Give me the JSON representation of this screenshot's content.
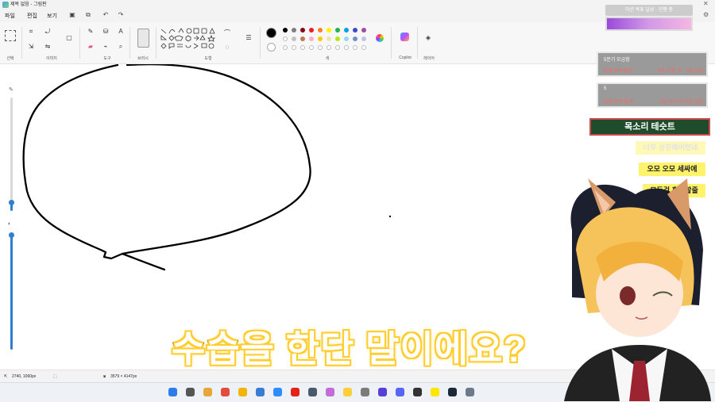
{
  "window": {
    "title": "제목 없음 - 그림판"
  },
  "menu": {
    "file": "파일",
    "edit": "편집",
    "view": "보기"
  },
  "ribbon": {
    "groups": {
      "select": "선택",
      "image": "이미지",
      "tools": "도구",
      "brushes": "브러시",
      "shapes": "도형",
      "colors": "색",
      "copilot": "Copilot",
      "layers": "레이어"
    },
    "text_tool": "A",
    "colors_row1": [
      "#000000",
      "#7f7f7f",
      "#880015",
      "#ed1c24",
      "#ff7f27",
      "#fff200",
      "#22b14c",
      "#00a2e8",
      "#3f48cc",
      "#a349a4"
    ],
    "colors_row2": [
      "#ffffff",
      "#c3c3c3",
      "#b97a57",
      "#ffaec9",
      "#ffc90e",
      "#efe4b0",
      "#b5e61d",
      "#99d9ea",
      "#7092be",
      "#c8bfe7"
    ],
    "primary_color": "#000000",
    "secondary_color": "#ffffff"
  },
  "status": {
    "cursor": "2740, 1060px",
    "canvas_size": "3579 × 4147px"
  },
  "overlay": {
    "top_banner": "미션 목표 달성 · 진행 중",
    "cards": [
      {
        "title": "5분기 모금함",
        "left": "연결 문제 발생",
        "right": "4주 10분 후 · 1회 남음"
      },
      {
        "title": "5",
        "left": "연결 문제 발생",
        "right": "4일 10시간 35분 남음"
      }
    ],
    "green_banner": "목소리 테슷트",
    "chat": [
      "너무 성장해버렸네",
      "오모 오모 세싸에",
      "모든걸 흡수할줄"
    ],
    "subtitle": "수습을 한단 말이에요?"
  },
  "icons": [
    "select-icon",
    "crop-icon",
    "resize-icon",
    "rotate-icon",
    "pencil-icon",
    "fill-icon",
    "text-icon",
    "eraser-icon",
    "picker-icon",
    "zoom-icon",
    "brush-icon",
    "copilot-icon",
    "layers-icon",
    "undo-icon",
    "redo-icon",
    "save-icon",
    "share-icon",
    "settings-icon"
  ],
  "taskbar": {
    "apps": [
      "windows",
      "search",
      "files",
      "chrome",
      "folder",
      "store",
      "mail",
      "youtube",
      "calc",
      "photos",
      "notes",
      "music",
      "vscode",
      "discord",
      "obs",
      "kakao",
      "steam",
      "settings"
    ]
  }
}
